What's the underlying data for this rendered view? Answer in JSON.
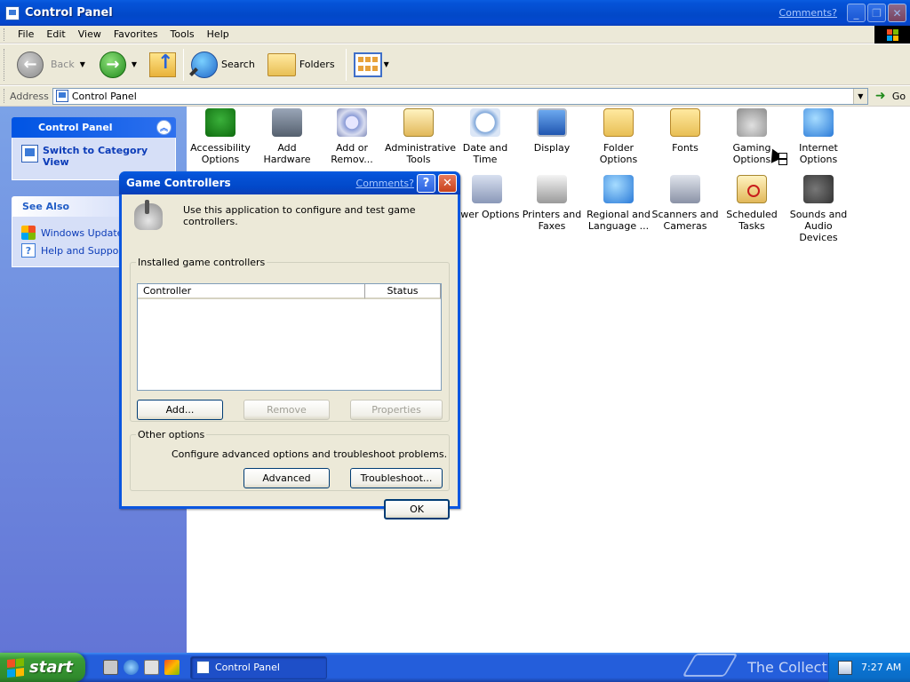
{
  "window": {
    "title": "Control Panel",
    "comments_link": "Comments?"
  },
  "menu": [
    "File",
    "Edit",
    "View",
    "Favorites",
    "Tools",
    "Help"
  ],
  "toolbar": {
    "back_label": "Back",
    "search_label": "Search",
    "folders_label": "Folders"
  },
  "address": {
    "label": "Address",
    "value": "Control Panel",
    "go_label": "Go"
  },
  "taskpane": {
    "control_panel": {
      "header": "Control Panel",
      "switch_link": "Switch to Category View"
    },
    "see_also": {
      "header": "See Also",
      "items": [
        "Windows Update",
        "Help and Support"
      ]
    }
  },
  "icons": [
    {
      "name": "accessibility",
      "label": "Accessibility Options"
    },
    {
      "name": "add-hardware",
      "label": "Add Hardware"
    },
    {
      "name": "add-remove",
      "label": "Add or Remov..."
    },
    {
      "name": "administrative-tools",
      "label": "Administrative Tools"
    },
    {
      "name": "date-time",
      "label": "Date and Time"
    },
    {
      "name": "display",
      "label": "Display"
    },
    {
      "name": "folder-options",
      "label": "Folder Options"
    },
    {
      "name": "fonts",
      "label": "Fonts"
    },
    {
      "name": "gaming-options",
      "label": "Gaming Options"
    },
    {
      "name": "internet-options",
      "label": "Internet Options"
    },
    {
      "name": "power-options",
      "label": "ower Options"
    },
    {
      "name": "printers-faxes",
      "label": "Printers and Faxes"
    },
    {
      "name": "regional-language",
      "label": "Regional and Language ..."
    },
    {
      "name": "scanners-cameras",
      "label": "Scanners and Cameras"
    },
    {
      "name": "scheduled-tasks",
      "label": "Scheduled Tasks"
    },
    {
      "name": "sounds-audio",
      "label": "Sounds and Audio Devices"
    }
  ],
  "dialog": {
    "title": "Game Controllers",
    "comments_link": "Comments?",
    "help_glyph": "?",
    "close_glyph": "✕",
    "intro": "Use this application to configure and test game controllers.",
    "installed_group": "Installed game controllers",
    "columns": [
      "Controller",
      "Status"
    ],
    "rows": [],
    "add_label": "Add...",
    "remove_label": "Remove",
    "properties_label": "Properties",
    "other_group": "Other options",
    "other_text": "Configure advanced options and troubleshoot problems.",
    "advanced_label": "Advanced",
    "troubleshoot_label": "Troubleshoot...",
    "ok_label": "OK"
  },
  "taskbar": {
    "start_label": "start",
    "task_label": "Control Panel",
    "clock": "7:27 AM",
    "watermark": "The Collection Book"
  },
  "colors": {
    "xp_blue": "#0553d8",
    "start_green": "#3a9c36",
    "taskpane_top": "#7ba2e7",
    "taskpane_bottom": "#6375d6",
    "link_blue": "#0c3cb8"
  }
}
